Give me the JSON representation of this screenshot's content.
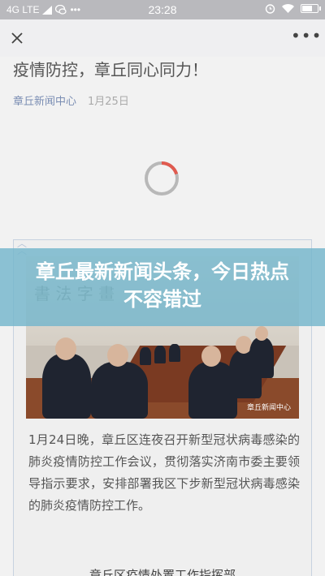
{
  "status_bar": {
    "network": "4G LTE",
    "time": "23:28"
  },
  "article": {
    "title": "疫情防控，章丘同心同力！",
    "source": "章丘新闻中心",
    "date": "1月25日",
    "paragraph": "1月24日晚，章丘区连夜召开新型冠状病毒感染的肺炎疫情防控工作会议，贯彻落实济南市委主要领导指示要求，安排部署我区下步新型冠状病毒感染的肺炎疫情防控工作。",
    "photo_watermark": "章丘新闻中心",
    "next_heading": "章丘区疫情处置工作指挥部"
  },
  "overlay": {
    "headline": "章丘最新新闻头条，今日热点不容错过"
  },
  "colors": {
    "overlay": "#74b6cc",
    "source_link": "#7a8db3",
    "spinner_accent": "#e05a4f"
  }
}
